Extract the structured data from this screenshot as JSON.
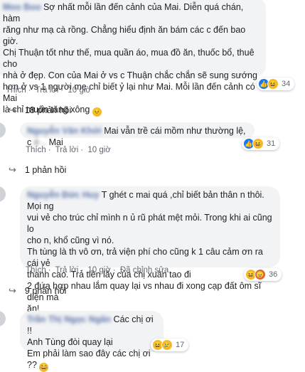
{
  "comments": [
    {
      "author": "Moo Boo",
      "lines": [
        "Sợ nhất mỗi lần đến cảnh của Mai. Diễn quá chán, hàm",
        "răng như mạ cà rồng. Chẳng hiểu định ăn bám các c đến bao giờ.",
        "Chị Thuận tốt như thế, mua quần áo, mua đồ ăn, thuốc bổ, thuê cho",
        "nhà ở đẹp. Con của Mai ở vs c Thuận chắc chắn sẽ sung sướng",
        "hơn ở vs 1 người mẹ chỉ biết ỷ lại như Mai. Mỗi lần đến cảnh có Mai",
        "là chỉ muốn tăng xông"
      ],
      "actions": [
        "Thích",
        "Trả lời",
        "10 giờ"
      ],
      "reaction_count": "34",
      "reactions": [
        "like-icon",
        "haha-icon"
      ],
      "replies": "18 phản hồi"
    },
    {
      "author": "Nguyễn Văn Khởi",
      "lines": [
        "Mai vẫn trề cái mồm như thường lệ, c",
        "Mai"
      ],
      "actions": [
        "Thích",
        "Trả lời",
        "10 giờ"
      ],
      "reaction_count": "31",
      "reactions": [
        "like-icon",
        "haha-icon"
      ],
      "replies": "1 phản hồi"
    },
    {
      "author": "Nguyễn Đức Huy",
      "lines": [
        "T ghét c mai quá ,chỉ biết bản thân n thôi. Mọi ng",
        "vui vẻ cho trúc chỉ mình n ủ rũ phát mệt mỏi. Trong khi ai cũng lo",
        "cho n, khổ cũng vì nó.",
        "Th tùng là th vô ơn, trả viện phí cho cũng k 1 câu cảm ơn ra cái vẻ",
        "thanh cao. Trả tiền lấy của chị xuân tao đi",
        "2 đứa hợp nhau lắm quay lại vs nhau đi xong cạp đất ôm sĩ diện mà",
        "ăn!"
      ],
      "actions": [
        "Thích",
        "Trả lời",
        "10 giờ",
        "Đã chỉnh sửa"
      ],
      "reaction_count": "36",
      "reactions": [
        "haha-icon",
        "angry-icon"
      ],
      "replies": "9 phản hồi"
    },
    {
      "author": "Trần Thị Ngọc Ngân",
      "lines": [
        "Các chị ơi !!",
        "Anh Tùng đòi quay lại",
        "Em phải làm sao đây các chị ơi ??"
      ],
      "actions": [
        "Thích",
        "Trả lời",
        "10 giờ"
      ],
      "reaction_count": "17",
      "reactions": [
        "haha-icon",
        "sad-icon"
      ]
    }
  ]
}
